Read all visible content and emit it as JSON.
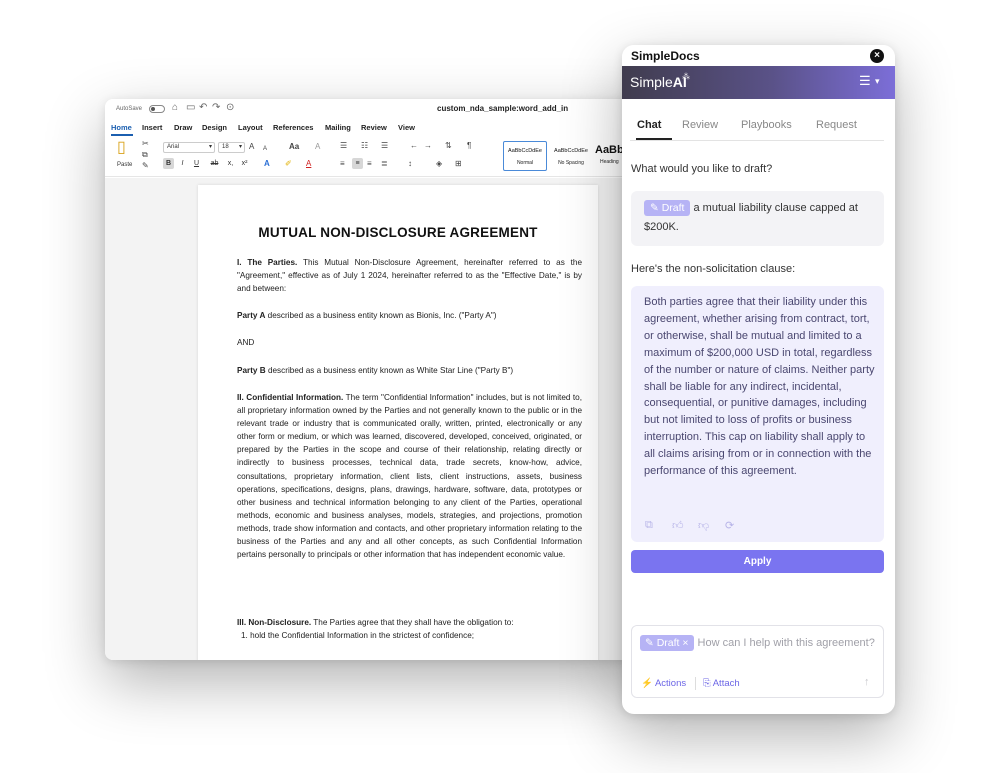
{
  "word": {
    "autosave_label": "AutoSave",
    "document_title": "custom_nda_sample:word_add_in",
    "menu": [
      "Home",
      "Insert",
      "Draw",
      "Design",
      "Layout",
      "References",
      "Mailing",
      "Review",
      "View"
    ],
    "ribbon": {
      "paste_label": "Paste",
      "font_name": "Arial",
      "font_size": "18",
      "styles": [
        {
          "sample": "AaBbCcDdEe",
          "name": "Normal"
        },
        {
          "sample": "AaBbCcDdEe",
          "name": "No Spacing"
        }
      ],
      "heading_sample": "AaBb",
      "heading_name": "Heading"
    },
    "document": {
      "heading": "MUTUAL NON-DISCLOSURE AGREEMENT",
      "s1_title": "I. The Parties.",
      "s1_text": "This Mutual Non-Disclosure Agreement, hereinafter referred to as the \"Agreement,\" effective as of July 1 2024, hereinafter referred to as the \"Effective Date,\" is by and between:",
      "party_a_label": "Party A",
      "party_a_text": "described as a business entity known as Bionis, Inc. (\"Party A\")",
      "and_text": "AND",
      "party_b_label": "Party B",
      "party_b_text": "described as a business entity known as White Star Line (\"Party B\")",
      "s2_title": "II. Confidential Information.",
      "s2_text": "The term \"Confidential Information\" includes, but is not limited to, all proprietary information owned by the Parties and not generally known to the public or in the relevant trade or industry that is communicated orally, written, printed, electronically or any other form or medium, or which was learned, discovered, developed, conceived, originated, or prepared by the Parties in the scope and course of their relationship, relating directly or indirectly to business processes, technical data, trade secrets, know-how, advice, consultations, proprietary information, client lists, client instructions, assets, business operations, specifications, designs, plans, drawings, hardware, software, data, prototypes or other business and technical information belonging to any client of the Parties, operational methods, economic and business analyses, models, strategies, and projections, promotion methods, trade show information and contacts, and other proprietary information relating to the business of the Parties and any and all other concepts, as such Confidential Information pertains personally to principals or other information that has independent economic value.",
      "s3_title": "III. Non-Disclosure.",
      "s3_text": "The Parties agree that they shall have the obligation to:",
      "s3_item1": "1. hold the Confidential Information in the strictest of confidence;"
    }
  },
  "panel": {
    "app_name": "SimpleDocs",
    "brand_simple": "Simple",
    "brand_ai": "AI",
    "tabs": [
      "Chat",
      "Review",
      "Playbooks",
      "Request"
    ],
    "prompt": "What would you like to draft?",
    "draft_chip": "Draft",
    "user_message": "a mutual liability clause capped at $200K.",
    "reply_intro": "Here's the non-solicitation clause:",
    "reply_text": "Both parties agree that their liability under this agreement, whether arising from contract, tort, or otherwise, shall be mutual and limited to a maximum of $200,000 USD in total, regardless of the number or nature of claims. Neither party shall be liable for any indirect, incidental, consequential, or punitive damages, including but not limited to loss of profits or business interruption. This cap on liability shall apply to all claims arising from or in connection with the performance of this agreement.",
    "apply_label": "Apply",
    "input_chip": "Draft ×",
    "input_placeholder": "How can I help with this agreement?",
    "actions_label": "Actions",
    "attach_label": "Attach"
  }
}
